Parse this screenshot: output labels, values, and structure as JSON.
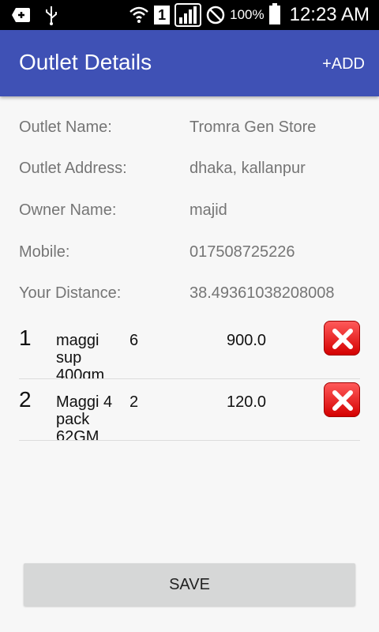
{
  "status_bar": {
    "battery_percent": "100%",
    "time": "12:23 AM",
    "sim_slot": "1",
    "icons": [
      "notification-add-icon",
      "usb-icon",
      "wifi-icon",
      "sim-icon",
      "signal-icon",
      "no-entry-icon",
      "battery-icon"
    ]
  },
  "app_bar": {
    "title": "Outlet Details",
    "add_label": "+ADD",
    "color": "#3f51b5"
  },
  "outlet": {
    "name_label": "Outlet Name:",
    "name_value": "Tromra Gen Store",
    "address_label": "Outlet Address:",
    "address_value": "dhaka, kallanpur",
    "owner_label": "Owner Name:",
    "owner_value": "majid",
    "mobile_label": "Mobile:",
    "mobile_value": "017508725226",
    "distance_label": "Your Distance:",
    "distance_value": "38.49361038208008"
  },
  "items": [
    {
      "index": "1",
      "name": "maggi sup 400gm",
      "qty": "6",
      "price": "900.0"
    },
    {
      "index": "2",
      "name": "Maggi 4 pack 62GM",
      "qty": "2",
      "price": "120.0"
    }
  ],
  "save_label": "SAVE"
}
